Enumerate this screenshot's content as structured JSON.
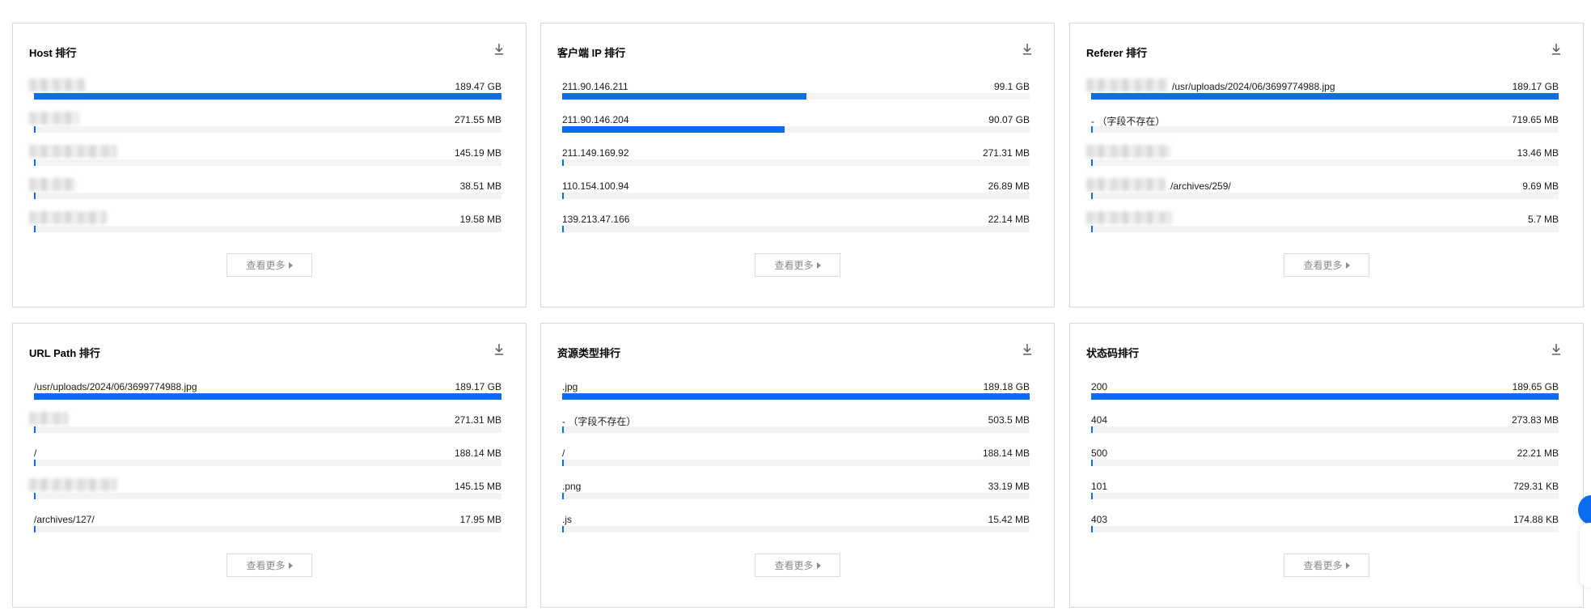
{
  "panels": [
    {
      "title": "Host 排行",
      "more_label": "查看更多",
      "rows": [
        {
          "label": "",
          "value": "189.47 GB",
          "fraction": 1.0
        },
        {
          "label": "",
          "value": "271.55 MB",
          "fraction": 0.004
        },
        {
          "label": "",
          "value": "145.19 MB",
          "fraction": 0.003
        },
        {
          "label": "",
          "value": "38.51 MB",
          "fraction": 0.002
        },
        {
          "label": "",
          "value": "19.58 MB",
          "fraction": 0.0
        }
      ]
    },
    {
      "title": "客户端 IP 排行",
      "more_label": "查看更多",
      "rows": [
        {
          "label": "211.90.146.211",
          "value": "99.1 GB",
          "fraction": 0.523
        },
        {
          "label": "211.90.146.204",
          "value": "90.07 GB",
          "fraction": 0.476
        },
        {
          "label": "211.149.169.92",
          "value": "271.31 MB",
          "fraction": 0.003
        },
        {
          "label": "110.154.100.94",
          "value": "26.89 MB",
          "fraction": 0.002
        },
        {
          "label": "139.213.47.166",
          "value": "22.14 MB",
          "fraction": 0.0
        }
      ]
    },
    {
      "title": "Referer 排行",
      "more_label": "查看更多",
      "rows": [
        {
          "label": "/usr/uploads/2024/06/3699774988.jpg",
          "value": "189.17 GB",
          "fraction": 1.0
        },
        {
          "label": "- （字段不存在）",
          "value": "719.65 MB",
          "fraction": 0.004
        },
        {
          "label": "",
          "value": "13.46 MB",
          "fraction": 0.0
        },
        {
          "label": "/archives/259/",
          "value": "9.69 MB",
          "fraction": 0.0
        },
        {
          "label": "",
          "value": "5.7 MB",
          "fraction": 0.0
        }
      ]
    },
    {
      "title": "URL Path 排行",
      "more_label": "查看更多",
      "rows": [
        {
          "label": "/usr/uploads/2024/06/3699774988.jpg",
          "value": "189.17 GB",
          "fraction": 1.0
        },
        {
          "label": "",
          "value": "271.31 MB",
          "fraction": 0.0
        },
        {
          "label": "/",
          "value": "188.14 MB",
          "fraction": 0.003
        },
        {
          "label": "",
          "value": "145.15 MB",
          "fraction": 0.003
        },
        {
          "label": "/archives/127/",
          "value": "17.95 MB",
          "fraction": 0.0
        }
      ]
    },
    {
      "title": "资源类型排行",
      "more_label": "查看更多",
      "rows": [
        {
          "label": ".jpg",
          "value": "189.18 GB",
          "fraction": 1.0
        },
        {
          "label": "- （字段不存在）",
          "value": "503.5 MB",
          "fraction": 0.004
        },
        {
          "label": "/",
          "value": "188.14 MB",
          "fraction": 0.003
        },
        {
          "label": ".png",
          "value": "33.19 MB",
          "fraction": 0.003
        },
        {
          "label": ".js",
          "value": "15.42 MB",
          "fraction": 0.0
        }
      ]
    },
    {
      "title": "状态码排行",
      "more_label": "查看更多",
      "rows": [
        {
          "label": "200",
          "value": "189.65 GB",
          "fraction": 1.0
        },
        {
          "label": "404",
          "value": "273.83 MB",
          "fraction": 0.003
        },
        {
          "label": "500",
          "value": "22.21 MB",
          "fraction": 0.0
        },
        {
          "label": "101",
          "value": "729.31 KB",
          "fraction": 0.0
        },
        {
          "label": "403",
          "value": "174.88 KB",
          "fraction": 0.0
        }
      ]
    }
  ],
  "colors": {
    "bar": "#0a6cef",
    "track": "#f2f3f5",
    "border": "#d9d9d9"
  },
  "icons": {
    "download": "download-icon",
    "more": "caret-right-icon"
  }
}
